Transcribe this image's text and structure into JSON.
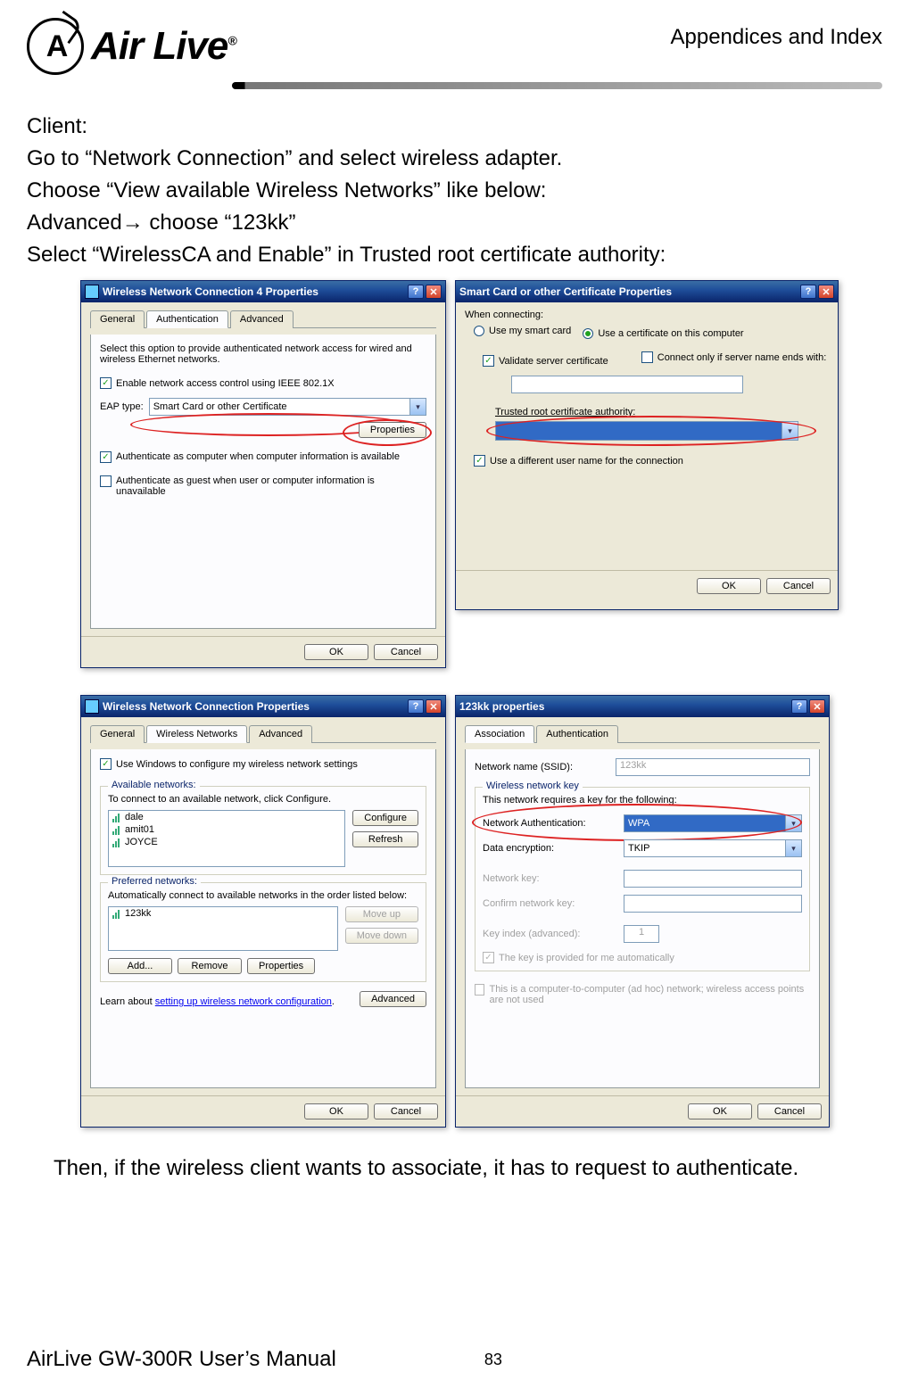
{
  "header": {
    "brand": "Air Live",
    "section": "Appendices and Index"
  },
  "intro": {
    "line1": "Client:",
    "line2": "Go to “Network Connection” and select wireless adapter.",
    "line3": "Choose “View available Wireless Networks” like below:",
    "line4": "Advanced→ choose “123kk”",
    "line5": "Select “WirelessCA and Enable” in Trusted root certificate authority:"
  },
  "win1": {
    "title": "Wireless Network Connection 4 Properties",
    "tabs": {
      "general": "General",
      "auth": "Authentication",
      "advanced": "Advanced"
    },
    "desc": "Select this option to provide authenticated network access for wired and wireless Ethernet networks.",
    "chk_enable": "Enable network access control using IEEE 802.1X",
    "eap_label": "EAP type:",
    "eap_value": "Smart Card or other Certificate",
    "btn_properties": "Properties",
    "chk_auth_computer": "Authenticate as computer when computer information is available",
    "chk_auth_guest": "Authenticate as guest when user or computer information is unavailable",
    "ok": "OK",
    "cancel": "Cancel"
  },
  "win2": {
    "title": "Smart Card or other Certificate Properties",
    "when_connecting": "When connecting:",
    "radio_smart": "Use my smart card",
    "radio_cert": "Use a certificate on this computer",
    "chk_validate": "Validate server certificate",
    "chk_connect_only": "Connect only if server name ends with:",
    "trusted_label": "Trusted root certificate authority:",
    "chk_diff_user": "Use a different user name for the connection",
    "ok": "OK",
    "cancel": "Cancel"
  },
  "win3": {
    "title": "Wireless Network Connection Properties",
    "tabs": {
      "general": "General",
      "wireless": "Wireless Networks",
      "advanced": "Advanced"
    },
    "chk_use_windows": "Use Windows to configure my wireless network settings",
    "available_label": "Available networks:",
    "available_desc": "To connect to an available network, click Configure.",
    "net_items": [
      "dale",
      "amit01",
      "JOYCE"
    ],
    "btn_configure": "Configure",
    "btn_refresh": "Refresh",
    "preferred_label": "Preferred networks:",
    "preferred_desc": "Automatically connect to available networks in the order listed below:",
    "pref_items": [
      "123kk"
    ],
    "btn_moveup": "Move up",
    "btn_movedown": "Move down",
    "btn_add": "Add...",
    "btn_remove": "Remove",
    "btn_properties": "Properties",
    "learn_text_pre": "Learn about ",
    "learn_link": "setting up wireless network configuration",
    "learn_text_post": ".",
    "btn_advanced": "Advanced",
    "ok": "OK",
    "cancel": "Cancel"
  },
  "win4": {
    "title": "123kk properties",
    "tabs": {
      "assoc": "Association",
      "auth": "Authentication"
    },
    "ssid_label": "Network name (SSID):",
    "ssid_value": "123kk",
    "wnk_label": "Wireless network key",
    "wnk_desc": "This network requires a key for the following:",
    "net_auth_label": "Network Authentication:",
    "net_auth_value": "WPA",
    "data_enc_label": "Data encryption:",
    "data_enc_value": "TKIP",
    "net_key_label": "Network key:",
    "confirm_key_label": "Confirm network key:",
    "key_index_label": "Key index (advanced):",
    "key_index_value": "1",
    "chk_auto": "The key is provided for me automatically",
    "chk_adhoc": "This is a computer-to-computer (ad hoc) network; wireless access points are not used",
    "ok": "OK",
    "cancel": "Cancel"
  },
  "closing": {
    "text": "Then, if the wireless client wants to associate, it has to request to authenticate."
  },
  "footer": {
    "manual": "AirLive GW-300R User’s Manual",
    "page": "83"
  }
}
